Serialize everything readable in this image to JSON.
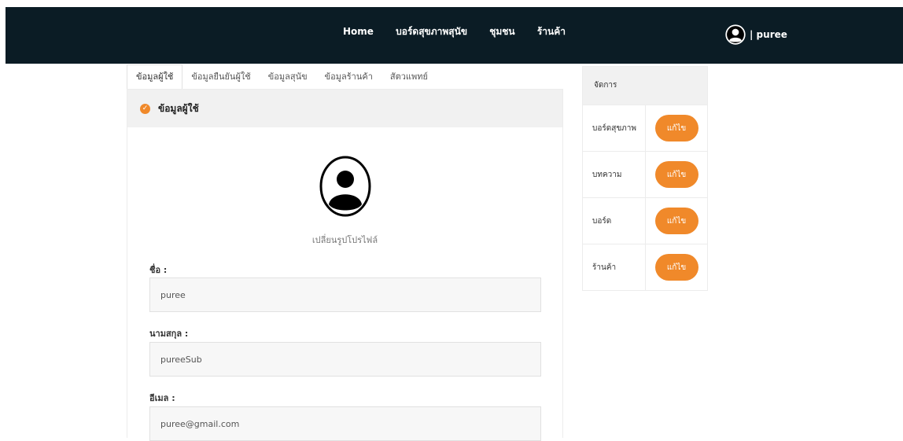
{
  "nav": {
    "items": [
      "Home",
      "บอร์ดสุขภาพสุนัข",
      "ชุมชน",
      "ร้านค้า"
    ]
  },
  "user": {
    "name": "| puree"
  },
  "tabs": [
    "ข้อมูลผู้ใช้",
    "ข้อมูลยืนยันผู้ใช้",
    "ข้อมูลสุนัข",
    "ข้อมูลร้านค้า",
    "สัตวแพทย์"
  ],
  "card": {
    "title": "ข้อมูลผู้ใช้",
    "change_picture": "เปลี่ยนรูปโปรไฟล์",
    "fields": [
      {
        "label": "ชื่อ :",
        "value": "puree"
      },
      {
        "label": "นามสกุล :",
        "value": "pureeSub"
      },
      {
        "label": "อีเมล :",
        "value": "puree@gmail.com"
      }
    ]
  },
  "manage": {
    "header": "จัดการ",
    "rows": [
      {
        "label": "บอร์ดสุขภาพ",
        "button": "แก้ไข"
      },
      {
        "label": "บทความ",
        "button": "แก้ไข"
      },
      {
        "label": "บอร์ด",
        "button": "แก้ไข"
      },
      {
        "label": "ร้านค้า",
        "button": "แก้ไข"
      }
    ]
  },
  "colors": {
    "topbar": "#0b1c25",
    "accent": "#f0892a"
  },
  "icons": {
    "user": "user-circle-icon",
    "check": "check-circle-icon"
  }
}
